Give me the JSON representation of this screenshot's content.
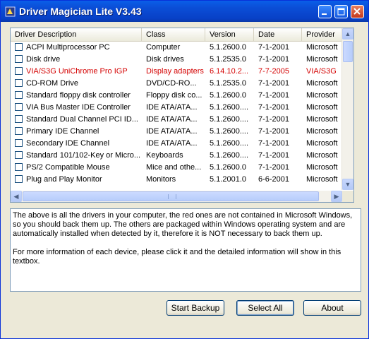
{
  "window": {
    "title": "Driver Magician Lite V3.43"
  },
  "columns": [
    "Driver Description",
    "Class",
    "Version",
    "Date",
    "Provider"
  ],
  "drivers": [
    {
      "description": "ACPI Multiprocessor PC",
      "class": "Computer",
      "version": "5.1.2600.0",
      "date": "7-1-2001",
      "provider": "Microsoft",
      "highlight": false
    },
    {
      "description": "Disk drive",
      "class": "Disk drives",
      "version": "5.1.2535.0",
      "date": "7-1-2001",
      "provider": "Microsoft",
      "highlight": false
    },
    {
      "description": "VIA/S3G UniChrome Pro IGP",
      "class": "Display adapters",
      "version": "6.14.10.2...",
      "date": "7-7-2005",
      "provider": "VIA/S3G",
      "highlight": true
    },
    {
      "description": "CD-ROM Drive",
      "class": "DVD/CD-RO...",
      "version": "5.1.2535.0",
      "date": "7-1-2001",
      "provider": "Microsoft",
      "highlight": false
    },
    {
      "description": "Standard floppy disk controller",
      "class": "Floppy disk co...",
      "version": "5.1.2600.0",
      "date": "7-1-2001",
      "provider": "Microsoft",
      "highlight": false
    },
    {
      "description": "VIA Bus Master IDE Controller",
      "class": "IDE ATA/ATA...",
      "version": "5.1.2600....",
      "date": "7-1-2001",
      "provider": "Microsoft",
      "highlight": false
    },
    {
      "description": "Standard Dual Channel PCI ID...",
      "class": "IDE ATA/ATA...",
      "version": "5.1.2600....",
      "date": "7-1-2001",
      "provider": "Microsoft",
      "highlight": false
    },
    {
      "description": "Primary IDE Channel",
      "class": "IDE ATA/ATA...",
      "version": "5.1.2600....",
      "date": "7-1-2001",
      "provider": "Microsoft",
      "highlight": false
    },
    {
      "description": "Secondary IDE Channel",
      "class": "IDE ATA/ATA...",
      "version": "5.1.2600....",
      "date": "7-1-2001",
      "provider": "Microsoft",
      "highlight": false
    },
    {
      "description": "Standard 101/102-Key or Micro...",
      "class": "Keyboards",
      "version": "5.1.2600....",
      "date": "7-1-2001",
      "provider": "Microsoft",
      "highlight": false
    },
    {
      "description": "PS/2 Compatible Mouse",
      "class": "Mice and othe...",
      "version": "5.1.2600.0",
      "date": "7-1-2001",
      "provider": "Microsoft",
      "highlight": false
    },
    {
      "description": "Plug and Play Monitor",
      "class": "Monitors",
      "version": "5.1.2001.0",
      "date": "6-6-2001",
      "provider": "Microsoft",
      "highlight": false
    }
  ],
  "info": {
    "paragraph1": "The above is all the drivers in your computer, the red ones are not contained in Microsoft Windows, so you should back them up. The others are packaged within Windows operating system and are automatically installed when detected by it, therefore it is NOT necessary to back them up.",
    "paragraph2": "For more information of each device, please click it and the detailed information will show in this textbox."
  },
  "buttons": {
    "backup": "Start Backup",
    "select_all": "Select All",
    "about": "About"
  },
  "colors": {
    "titlebar": "#0a5fe8",
    "highlight_text": "#d40000"
  }
}
